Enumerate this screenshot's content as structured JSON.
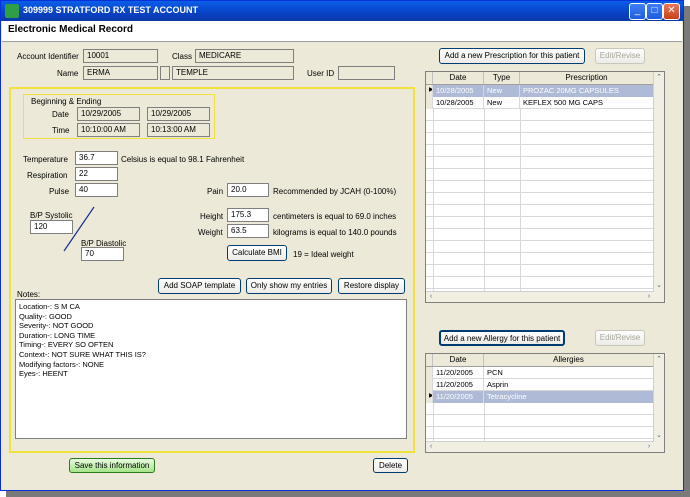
{
  "window": {
    "title": "309999 STRATFORD RX TEST ACCOUNT",
    "minimize": "_",
    "maximize": "□",
    "close": "✕"
  },
  "header": {
    "title": "Electronic Medical Record"
  },
  "account": {
    "id_label": "Account Identifier",
    "id_value": "10001",
    "class_label": "Class",
    "class_value": "MEDICARE",
    "name_label": "Name",
    "first_name": "ERMA",
    "middle_initial": "",
    "last_name": "TEMPLE",
    "userid_label": "User ID",
    "userid_value": ""
  },
  "visit": {
    "section_label": "Beginning & Ending",
    "date_label": "Date",
    "date_begin": "10/29/2005",
    "date_end": "10/29/2005",
    "time_label": "Time",
    "time_begin": "10:10:00 AM",
    "time_end": "10:13:00 AM"
  },
  "vitals": {
    "temp_label": "Temperature",
    "temp_value": "36.7",
    "temp_note": "Celsius is equal to 98.1 Fahrenheit",
    "resp_label": "Respiration",
    "resp_value": "22",
    "pulse_label": "Pulse",
    "pulse_value": "40",
    "pain_label": "Pain",
    "pain_value": "20.0",
    "pain_note": "Recommended by JCAH (0-100%)",
    "bp_sys_label": "B/P Systolic",
    "bp_sys_value": "120",
    "bp_dia_label": "B/P Diastolic",
    "bp_dia_value": "70",
    "height_label": "Height",
    "height_value": "175.3",
    "height_note": "centimeters is equal to 69.0 inches",
    "weight_label": "Weight",
    "weight_value": "63.5",
    "weight_note": "kilograms is equal to 140.0 pounds",
    "bmi_button": "Calculate BMI",
    "bmi_note": "19 = Ideal weight"
  },
  "actions": {
    "soap_button": "Add SOAP template",
    "my_entries_button": "Only show my entries",
    "restore_button": "Restore display",
    "save_button": "Save this information",
    "delete_button": "Delete"
  },
  "notes": {
    "label": "Notes:",
    "lines": [
      "Location-: S M CA",
      "Quality-:  GOOD",
      "Severity-:  NOT GOOD",
      "Duration-:  LONG TIME",
      "Timing-:  EVERY SO OFTEN",
      "Context-:  NOT SURE WHAT THIS IS?",
      "Modifying factors-: NONE",
      "Eyes-: HEENT"
    ]
  },
  "prescriptions": {
    "add_button": "Add a new Prescription for this patient",
    "edit_button": "Edit/Revise",
    "columns": [
      "Date",
      "Type",
      "Prescription"
    ],
    "rows": [
      {
        "date": "10/28/2005",
        "type": "New",
        "rx": "PROZAC 20MG CAPSULES",
        "selected": true
      },
      {
        "date": "10/28/2005",
        "type": "New",
        "rx": "KEFLEX 500 MG CAPS",
        "selected": false
      }
    ]
  },
  "allergies": {
    "add_button": "Add a new Allergy for this patient",
    "edit_button": "Edit/Revise",
    "columns": [
      "Date",
      "Allergies"
    ],
    "rows": [
      {
        "date": "11/20/2005",
        "allergy": "PCN",
        "selected": false
      },
      {
        "date": "11/20/2005",
        "allergy": "Asprin",
        "selected": false
      },
      {
        "date": "11/20/2005",
        "allergy": "Tetracycline",
        "selected": true
      }
    ]
  },
  "colors": {
    "title_bar": "#0842c4",
    "selection": "#aebad6",
    "highlight_border": "#f0e23c",
    "save_button": "#a6e48a"
  }
}
